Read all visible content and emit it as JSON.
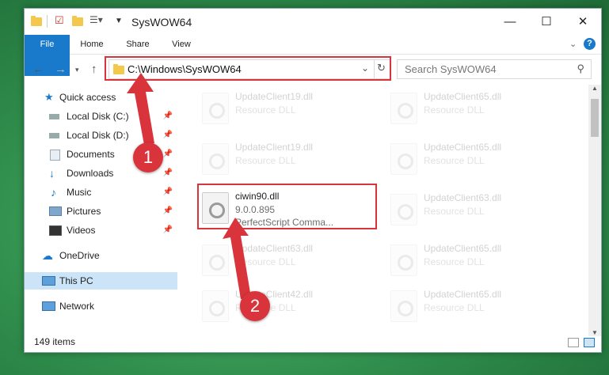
{
  "window": {
    "title": "SysWOW64"
  },
  "ribbon": {
    "tabs": [
      "File",
      "Home",
      "Share",
      "View"
    ]
  },
  "address": {
    "path": "C:\\Windows\\SysWOW64"
  },
  "search": {
    "placeholder": "Search SysWOW64"
  },
  "sidebar": {
    "items": [
      {
        "label": "Quick access"
      },
      {
        "label": "Local Disk (C:)"
      },
      {
        "label": "Local Disk (D:)"
      },
      {
        "label": "Documents"
      },
      {
        "label": "Downloads"
      },
      {
        "label": "Music"
      },
      {
        "label": "Pictures"
      },
      {
        "label": "Videos"
      },
      {
        "label": "OneDrive"
      },
      {
        "label": "This PC"
      },
      {
        "label": "Network"
      }
    ]
  },
  "files": {
    "left": [
      {
        "name": "UpdateClient19.dll",
        "type": "Resource DLL"
      },
      {
        "name": "UpdateClient19.dll",
        "type": "Resource DLL"
      },
      {
        "name": "ciwin90.dll",
        "version": "9.0.0.895",
        "desc": "PerfectScript Comma..."
      },
      {
        "name": "UpdateClient63.dll",
        "type": "Resource DLL"
      },
      {
        "name": "UpdateClient42.dll",
        "type": "Resource DLL"
      }
    ],
    "right": [
      {
        "name": "UpdateClient65.dll",
        "type": "Resource DLL"
      },
      {
        "name": "UpdateClient65.dll",
        "type": "Resource DLL"
      },
      {
        "name": "UpdateClient63.dll",
        "type": "Resource DLL"
      },
      {
        "name": "UpdateClient65.dll",
        "type": "Resource DLL"
      },
      {
        "name": "UpdateClient65.dll",
        "type": "Resource DLL"
      }
    ]
  },
  "status": {
    "items": "149 items"
  },
  "steps": [
    "1",
    "2"
  ],
  "colors": {
    "accent": "#1979ca",
    "highlight": "#d9343b"
  }
}
